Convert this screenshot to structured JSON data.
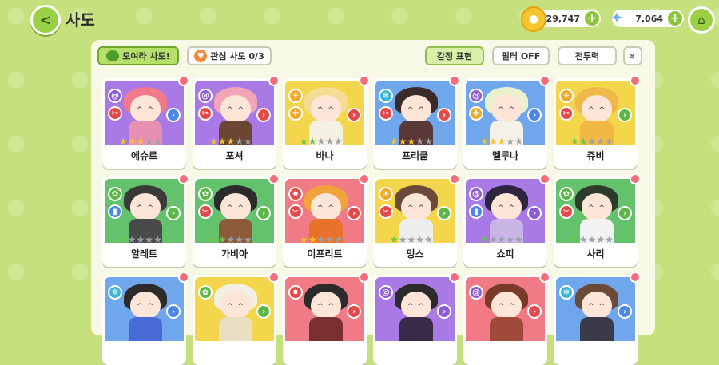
{
  "header": {
    "back_label": "<",
    "title": "사도",
    "coins": "729,747",
    "gems": "7,064",
    "plus": "+",
    "home_label": "⌂"
  },
  "toolbar": {
    "gather": "모여라 사도!",
    "favorites": "관심 사도  0/3",
    "emote": "감정 표현",
    "filter": "필터 OFF",
    "power": "전투력",
    "expand": "»"
  },
  "cards": [
    {
      "name": "에슈르",
      "bg": "#a979e6",
      "hair": "#f07a8a",
      "outfit": "#e88fb4",
      "stars": 3,
      "star_style": "gold",
      "e1": "@",
      "e2": "✂",
      "c1": "#8e5bd6",
      "c2": "#e44848",
      "arrow": "#4b86e8"
    },
    {
      "name": "포셔",
      "bg": "#a979e6",
      "hair": "#f3a5b6",
      "outfit": "#6b4634",
      "stars": 3,
      "star_style": "gold",
      "e1": "@",
      "e2": "✂",
      "c1": "#8e5bd6",
      "c2": "#e44848",
      "arrow": "#e44848"
    },
    {
      "name": "바나",
      "bg": "#f3d64b",
      "hair": "#f4dc94",
      "outfit": "#f4f0e2",
      "stars": 2,
      "star_style": "green",
      "e1": "☀",
      "e2": "✚",
      "c1": "#f0a82c",
      "c2": "#f0a82c",
      "arrow": "#e44848"
    },
    {
      "name": "프리클",
      "bg": "#6fa6ec",
      "hair": "#3b2a2a",
      "outfit": "#5a3838",
      "stars": 3,
      "star_style": "gold",
      "e1": "❄",
      "e2": "✂",
      "c1": "#3fb6d6",
      "c2": "#e44848",
      "arrow": "#e44848"
    },
    {
      "name": "멜루나",
      "bg": "#6fa6ec",
      "hair": "#eaf1cf",
      "outfit": "#f5f1e6",
      "stars": 3,
      "star_style": "gold",
      "e1": "@",
      "e2": "✚",
      "c1": "#8e5bd6",
      "c2": "#f0a82c",
      "arrow": "#4b86e8"
    },
    {
      "name": "쥬비",
      "bg": "#f3d64b",
      "hair": "#f0b848",
      "outfit": "#f2b844",
      "stars": 2,
      "star_style": "green",
      "e1": "☀",
      "e2": "✂",
      "c1": "#f0a82c",
      "c2": "#e44848",
      "arrow": "#5cb846"
    },
    {
      "name": "알레트",
      "bg": "#64c26c",
      "hair": "#3a3a3a",
      "outfit": "#4a4a4a",
      "stars": 1,
      "star_style": "green",
      "e1": "✿",
      "e2": "▮",
      "c1": "#5cb846",
      "c2": "#4b86e8",
      "arrow": "#5cb846"
    },
    {
      "name": "가비아",
      "bg": "#64c26c",
      "hair": "#2b2b2b",
      "outfit": "#8c5a3a",
      "stars": 2,
      "star_style": "green",
      "e1": "✿",
      "e2": "✂",
      "c1": "#5cb846",
      "c2": "#e44848",
      "arrow": "#5cb846"
    },
    {
      "name": "이프리트",
      "bg": "#f07a86",
      "hair": "#f2a23a",
      "outfit": "#e9722a",
      "stars": 2,
      "star_style": "gold",
      "e1": "✸",
      "e2": "✂",
      "c1": "#e44848",
      "c2": "#e44848",
      "arrow": "#e44848"
    },
    {
      "name": "밍스",
      "bg": "#f3d64b",
      "hair": "#6b4a3a",
      "outfit": "#eeeeee",
      "stars": 1,
      "star_style": "green",
      "e1": "☀",
      "e2": "✂",
      "c1": "#f0a82c",
      "c2": "#e44848",
      "arrow": "#5cb846"
    },
    {
      "name": "쇼피",
      "bg": "#a979e6",
      "hair": "#2f2440",
      "outfit": "#c9b6e6",
      "stars": 1,
      "star_style": "green",
      "e1": "@",
      "e2": "▮",
      "c1": "#8e5bd6",
      "c2": "#4b86e8",
      "arrow": "#8e5bd6"
    },
    {
      "name": "사리",
      "bg": "#64c26c",
      "hair": "#2e3a2a",
      "outfit": "#f2f2f2",
      "stars": 1,
      "star_style": "green",
      "e1": "✿",
      "e2": "✂",
      "c1": "#5cb846",
      "c2": "#e44848",
      "arrow": "#5cb846"
    },
    {
      "name": "",
      "bg": "#6fa6ec",
      "hair": "#2b2b2b",
      "outfit": "#4a6bd6",
      "stars": 0,
      "star_style": "green",
      "e1": "❄",
      "e2": "",
      "c1": "#3fb6d6",
      "c2": "#3fb6d6",
      "arrow": "#4b86e8"
    },
    {
      "name": "",
      "bg": "#f3d64b",
      "hair": "#f3efe2",
      "outfit": "#e9e0c4",
      "stars": 0,
      "star_style": "green",
      "e1": "✿",
      "e2": "",
      "c1": "#5cb846",
      "c2": "#5cb846",
      "arrow": "#5cb846"
    },
    {
      "name": "",
      "bg": "#f07a86",
      "hair": "#2b2b2b",
      "outfit": "#7a3030",
      "stars": 0,
      "star_style": "green",
      "e1": "✸",
      "e2": "",
      "c1": "#e44848",
      "c2": "#e44848",
      "arrow": "#e44848"
    },
    {
      "name": "",
      "bg": "#a979e6",
      "hair": "#2b2b2b",
      "outfit": "#3a2a4a",
      "stars": 0,
      "star_style": "green",
      "e1": "@",
      "e2": "",
      "c1": "#8e5bd6",
      "c2": "#8e5bd6",
      "arrow": "#8e5bd6"
    },
    {
      "name": "",
      "bg": "#f07a86",
      "hair": "#7a3a2a",
      "outfit": "#a04a3a",
      "stars": 0,
      "star_style": "green",
      "e1": "@",
      "e2": "",
      "c1": "#8e5bd6",
      "c2": "#8e5bd6",
      "arrow": "#e44848"
    },
    {
      "name": "",
      "bg": "#6fa6ec",
      "hair": "#6b4a3a",
      "outfit": "#3a3a4a",
      "stars": 0,
      "star_style": "green",
      "e1": "❄",
      "e2": "",
      "c1": "#3fb6d6",
      "c2": "#3fb6d6",
      "arrow": "#4b86e8"
    }
  ]
}
